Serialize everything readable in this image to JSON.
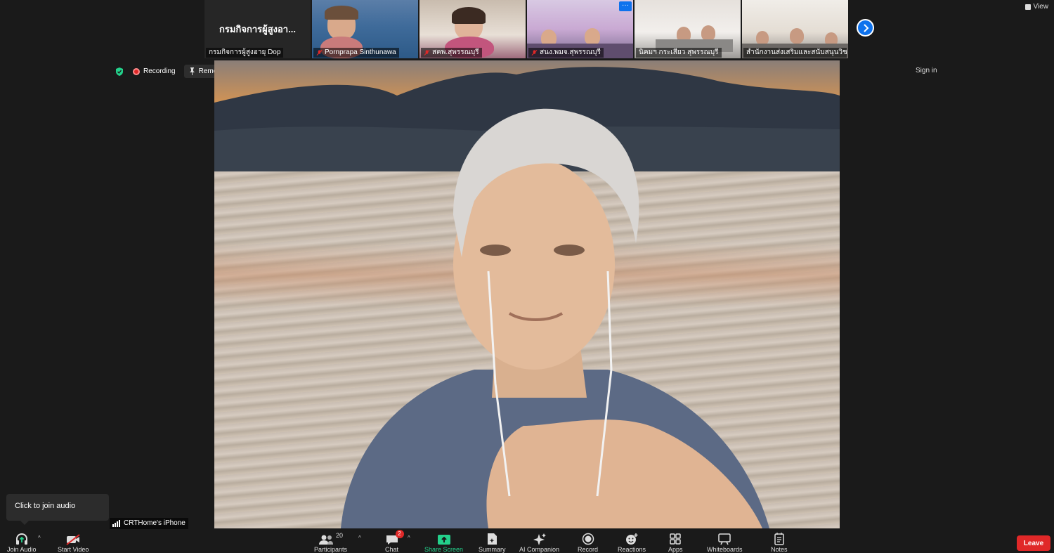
{
  "header": {
    "view_label": "View",
    "sign_in_label": "Sign in"
  },
  "thumbnails": [
    {
      "caption": "กรมกิจการผู้สูงอายุ Dop",
      "display_name": "กรมกิจการผู้สูงอา...",
      "video": false,
      "muted": false
    },
    {
      "caption": "Pornprapa Sinthunawa",
      "video": true,
      "muted": true
    },
    {
      "caption": "สคพ.สุพรรณบุรี",
      "video": true,
      "muted": true
    },
    {
      "caption": "สนง.พมจ.สุพรรณบุรี",
      "video": true,
      "muted": true,
      "more": "···"
    },
    {
      "caption": "นิคมฯ กระเสียว สุพรรณบุรี",
      "video": true,
      "muted": false
    },
    {
      "caption": "สำนักงานส่งเสริมและสนับสนุนวิชาก...",
      "video": true,
      "muted": false
    }
  ],
  "status": {
    "recording_label": "Recording",
    "remove_pin_label": "Remove Pin"
  },
  "main_video": {
    "participant_name": "CRTHome's iPhone"
  },
  "tooltip": {
    "text": "Click to join audio"
  },
  "toolbar": {
    "join_audio": "Join Audio",
    "start_video": "Start Video",
    "participants": "Participants",
    "participants_count": "20",
    "chat": "Chat",
    "chat_badge": "2",
    "share_screen": "Share Screen",
    "summary": "Summary",
    "ai_companion": "AI Companion",
    "record": "Record",
    "reactions": "Reactions",
    "apps": "Apps",
    "whiteboards": "Whiteboards",
    "notes": "Notes",
    "leave": "Leave"
  },
  "colors": {
    "accent": "#0e72ed",
    "danger": "#e02828",
    "share_green": "#23d18b",
    "background": "#1a1a1a"
  }
}
